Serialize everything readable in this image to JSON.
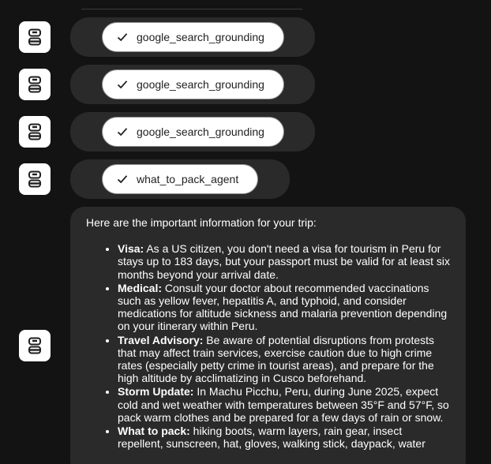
{
  "tool_calls": [
    {
      "label": "google_search_grounding"
    },
    {
      "label": "google_search_grounding"
    },
    {
      "label": "google_search_grounding"
    },
    {
      "label": "what_to_pack_agent"
    }
  ],
  "message": {
    "intro": "Here are the important information for your trip:",
    "items": [
      {
        "title": "Visa:",
        "text": " As a US citizen, you don't need a visa for tourism in Peru for stays up to 183 days, but your passport must be valid for at least six months beyond your arrival date."
      },
      {
        "title": "Medical:",
        "text": " Consult your doctor about recommended vaccinations such as yellow fever, hepatitis A, and typhoid, and consider medications for altitude sickness and malaria prevention depending on your itinerary within Peru."
      },
      {
        "title": "Travel Advisory:",
        "text": " Be aware of potential disruptions from protests that may affect train services, exercise caution due to high crime rates (especially petty crime in tourist areas), and prepare for the high altitude by acclimatizing in Cusco beforehand."
      },
      {
        "title": "Storm Update:",
        "text": " In Machu Picchu, Peru, during June 2025, expect cold and wet weather with temperatures between 35°F and 57°F, so pack warm clothes and be prepared for a few days of rain or snow."
      },
      {
        "title": "What to pack:",
        "text": " hiking boots, warm layers, rain gear, insect repellent, sunscreen, hat, gloves, walking stick, daypack, water"
      }
    ]
  }
}
